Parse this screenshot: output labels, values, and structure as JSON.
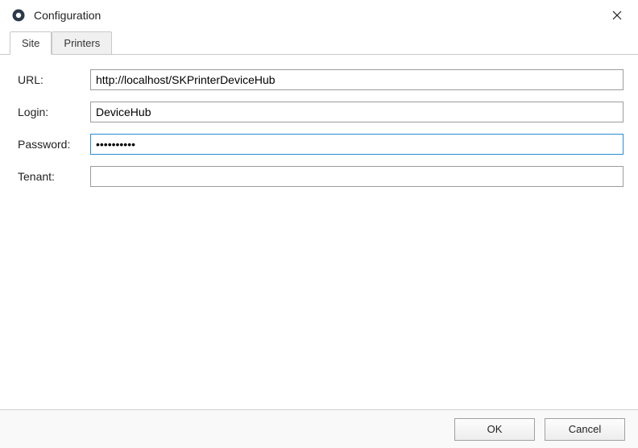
{
  "window": {
    "title": "Configuration"
  },
  "tabs": {
    "site": "Site",
    "printers": "Printers"
  },
  "form": {
    "url_label": "URL:",
    "url_value": "http://localhost/SKPrinterDeviceHub",
    "login_label": "Login:",
    "login_value": "DeviceHub",
    "password_label": "Password:",
    "password_value": "••••••••••",
    "tenant_label": "Tenant:",
    "tenant_value": ""
  },
  "buttons": {
    "ok": "OK",
    "cancel": "Cancel"
  }
}
